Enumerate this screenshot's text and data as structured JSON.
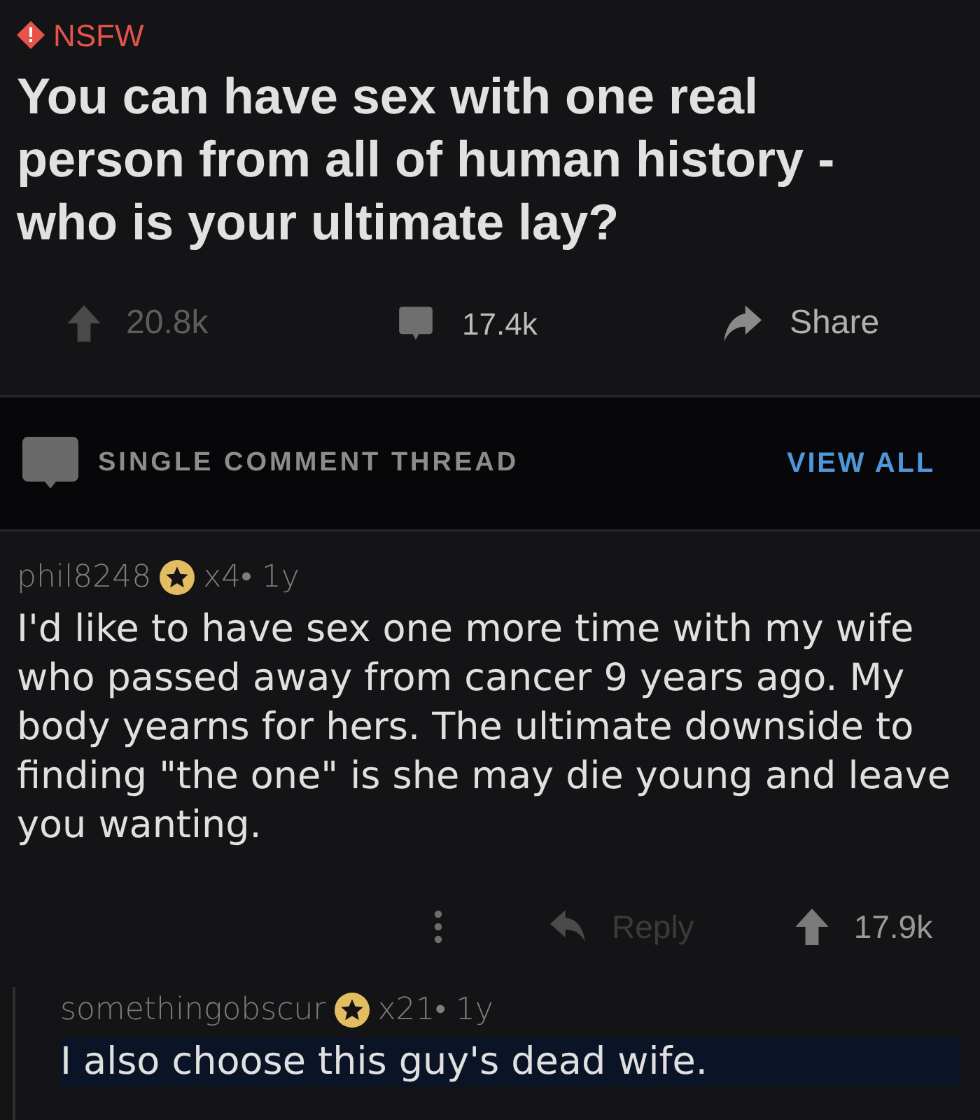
{
  "post": {
    "nsfw_label": "NSFW",
    "title": "You can have sex with one real person from all of human history - who is your ultimate lay?",
    "upvotes": "20.8k",
    "comments": "17.4k",
    "share": "Share"
  },
  "thread_header": {
    "label": "SINGLE COMMENT THREAD",
    "view_all": "VIEW ALL"
  },
  "comments": [
    {
      "author": "phil8248",
      "meta": "x4• 1y",
      "body": "I'd like to have sex one more time with my wife who passed away from cancer 9 years ago. My body yearns for hers. The ultimate downside to finding \"the one\" is she may die young and leave you wanting.",
      "highlighted": false,
      "actions": {
        "reply": {
          "label": "Reply",
          "disabled": true
        },
        "score": "17.9k"
      },
      "children": [
        {
          "author": "somethingobscur",
          "meta": "x21• 1y",
          "body": "I also choose this guy's dead wife.",
          "highlighted": true
        }
      ]
    }
  ]
}
